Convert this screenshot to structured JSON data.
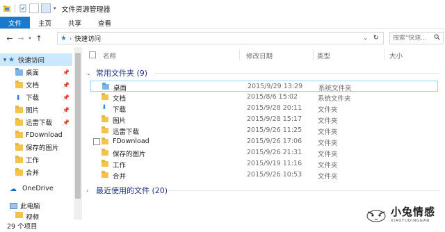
{
  "window": {
    "title": "文件资源管理器"
  },
  "ribbon": {
    "tabs": [
      "文件",
      "主页",
      "共享",
      "查看"
    ]
  },
  "address": {
    "crumb": "快速访问",
    "search_placeholder": "搜索\"快速..."
  },
  "sidebar": {
    "items": [
      {
        "label": "快速访问",
        "icon": "star-icon",
        "selected": true,
        "pinned": false
      },
      {
        "label": "桌面",
        "icon": "desktop-folder-icon",
        "pinned": true
      },
      {
        "label": "文档",
        "icon": "documents-folder-icon",
        "pinned": true
      },
      {
        "label": "下载",
        "icon": "download-folder-icon",
        "pinned": true
      },
      {
        "label": "图片",
        "icon": "pictures-folder-icon",
        "pinned": true
      },
      {
        "label": "迅雷下载",
        "icon": "folder-icon",
        "pinned": true
      },
      {
        "label": "FDownload",
        "icon": "folder-icon",
        "pinned": false
      },
      {
        "label": "保存的图片",
        "icon": "folder-icon",
        "pinned": false
      },
      {
        "label": "工作",
        "icon": "folder-icon",
        "pinned": false
      },
      {
        "label": "合并",
        "icon": "folder-icon",
        "pinned": false
      },
      {
        "label": "OneDrive",
        "icon": "onedrive-cloud-icon",
        "pinned": false
      },
      {
        "label": "此电脑",
        "icon": "this-pc-icon",
        "pinned": false
      },
      {
        "label": "视频",
        "icon": "videos-folder-icon",
        "pinned": false
      }
    ]
  },
  "columns": {
    "name": "名称",
    "modified": "修改日期",
    "type": "类型",
    "size": "大小"
  },
  "groups": {
    "frequent": {
      "label": "常用文件夹 (9)"
    },
    "recent": {
      "label": "最近使用的文件 (20)"
    }
  },
  "rows": [
    {
      "name": "桌面",
      "date": "2015/9/29 13:29",
      "type": "系统文件夹",
      "icon": "desktop-folder-icon"
    },
    {
      "name": "文档",
      "date": "2015/8/6 15:02",
      "type": "系统文件夹",
      "icon": "documents-folder-icon"
    },
    {
      "name": "下载",
      "date": "2015/9/28 20:11",
      "type": "文件夹",
      "icon": "download-folder-icon"
    },
    {
      "name": "图片",
      "date": "2015/9/28 15:17",
      "type": "文件夹",
      "icon": "pictures-folder-icon"
    },
    {
      "name": "迅雷下载",
      "date": "2015/9/26 11:25",
      "type": "文件夹",
      "icon": "folder-icon"
    },
    {
      "name": "FDownload",
      "date": "2015/9/26 17:06",
      "type": "文件夹",
      "icon": "folder-icon"
    },
    {
      "name": "保存的图片",
      "date": "2015/9/26 21:31",
      "type": "文件夹",
      "icon": "folder-icon"
    },
    {
      "name": "工作",
      "date": "2015/9/19 11:16",
      "type": "文件夹",
      "icon": "folder-icon"
    },
    {
      "name": "合并",
      "date": "2015/9/26 10:53",
      "type": "文件夹",
      "icon": "folder-icon"
    }
  ],
  "status": {
    "count": "29 个项目"
  },
  "watermark": {
    "title": "小兔情感",
    "subtitle": "XIAOTUQINGGAN"
  },
  "colors": {
    "accent": "#1979ca",
    "selection": "#cce8ff",
    "hover_border": "#99d1ff",
    "group_heading": "#1e3287",
    "folder": "#f2c44c"
  }
}
